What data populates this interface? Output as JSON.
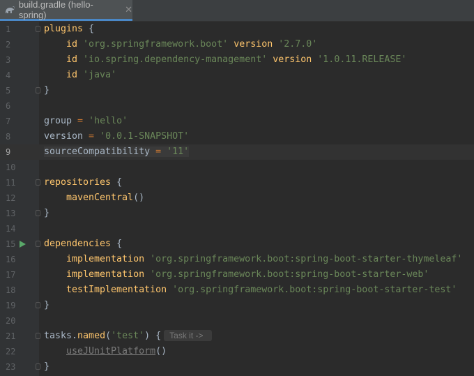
{
  "tab": {
    "title": "build.gradle (hello-spring)",
    "close": "✕"
  },
  "editor": {
    "current_line": 9,
    "lines": [
      {
        "n": "1"
      },
      {
        "n": "2"
      },
      {
        "n": "3"
      },
      {
        "n": "4"
      },
      {
        "n": "5"
      },
      {
        "n": "6"
      },
      {
        "n": "7"
      },
      {
        "n": "8"
      },
      {
        "n": "9"
      },
      {
        "n": "10"
      },
      {
        "n": "11"
      },
      {
        "n": "12"
      },
      {
        "n": "13"
      },
      {
        "n": "14"
      },
      {
        "n": "15"
      },
      {
        "n": "16"
      },
      {
        "n": "17"
      },
      {
        "n": "18"
      },
      {
        "n": "19"
      },
      {
        "n": "20"
      },
      {
        "n": "21"
      },
      {
        "n": "22"
      },
      {
        "n": "23"
      }
    ],
    "code": {
      "plugins": "plugins",
      "brace_open": " {",
      "brace_close": "}",
      "id": "id",
      "version_kw": "version",
      "p1": "'org.springframework.boot'",
      "p1v": "'2.7.0'",
      "p2": "'io.spring.dependency-management'",
      "p2v": "'1.0.11.RELEASE'",
      "p3": "'java'",
      "group": "group",
      "eq": " = ",
      "group_val": "'hello'",
      "version": "version",
      "version_val": "'0.0.1-SNAPSHOT'",
      "source": "sourceCompatibility",
      "source_val": "'11'",
      "repositories": "repositories",
      "maven": "mavenCentral",
      "parens": "()",
      "dependencies": "dependencies",
      "impl": "implementation",
      "d1": "'org.springframework.boot:spring-boot-starter-thymeleaf'",
      "d2": "'org.springframework.boot:spring-boot-starter-web'",
      "test_impl": "testImplementation",
      "d3": "'org.springframework.boot:spring-boot-starter-test'",
      "tasks": "tasks",
      "dot": ".",
      "named": "named",
      "paren_open": "(",
      "test_arg": "'test'",
      "paren_close": ")",
      "hint": "Task it ->",
      "junit": "useJUnitPlatform"
    }
  }
}
